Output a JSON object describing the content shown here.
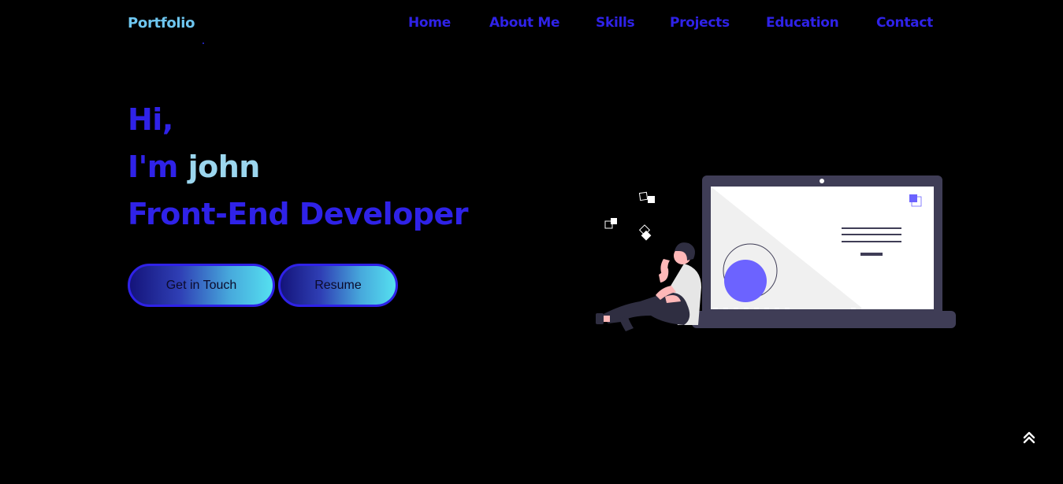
{
  "header": {
    "logo": "Portfolio",
    "nav": [
      {
        "label": "Home"
      },
      {
        "label": "About Me"
      },
      {
        "label": "Skills"
      },
      {
        "label": "Projects"
      },
      {
        "label": "Education"
      },
      {
        "label": "Contact"
      }
    ]
  },
  "hero": {
    "greeting": "Hi,",
    "intro_prefix": "I'm ",
    "name": "john",
    "role": "Front-End Developer",
    "buttons": {
      "contact_label": "Get in Touch",
      "resume_label": "Resume"
    }
  },
  "icons": {
    "illustration": "developer-laptop-illustration",
    "scroll_top": "double-chevron-up-icon"
  },
  "colors": {
    "background": "#000000",
    "accent": "#2f22e8",
    "logo": "#6ec6f0",
    "name_highlight": "#9bd6ee",
    "illustration_purple": "#6c63ff"
  }
}
